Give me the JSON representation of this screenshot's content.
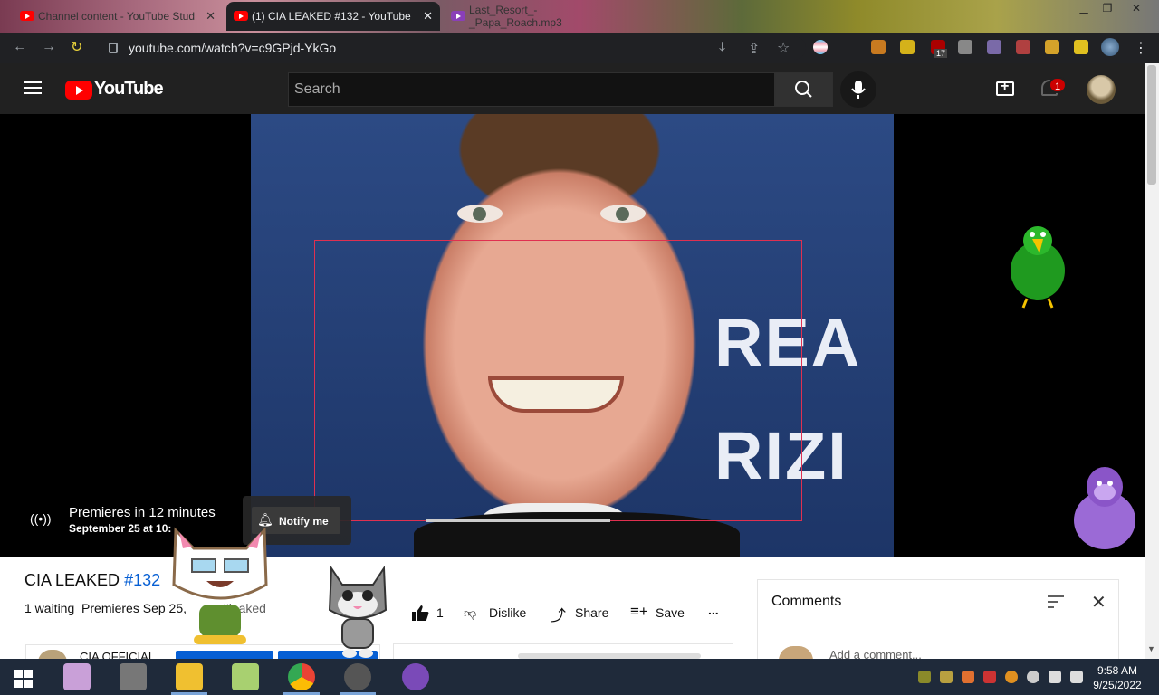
{
  "browser": {
    "tabs": [
      {
        "label": "Channel content - YouTube Stud",
        "active": false
      },
      {
        "label": "(1) CIA LEAKED #132 - YouTube",
        "active": true
      },
      {
        "label": "Last_Resort_-_Papa_Roach.mp3",
        "active": false
      }
    ],
    "url": "youtube.com/watch?v=c9GPjd-YkGo",
    "extension_badge": "17"
  },
  "youtube": {
    "logo_text": "YouTube",
    "search_placeholder": "Search",
    "notification_count": "1"
  },
  "video": {
    "background_text_1": "REA",
    "background_text_2": "RIZI",
    "premiere_title": "Premieres in 12 minutes",
    "premiere_subtitle": "September 25 at 10:",
    "notify_label": "Notify me"
  },
  "info": {
    "title_main": "CIA LEAKED ",
    "title_hashtag": "#132",
    "waiting": "1 waiting",
    "premieres": "Premieres Sep 25,",
    "tag": "#leaked",
    "likes": "1",
    "dislike_label": "Dislike",
    "share_label": "Share",
    "save_label": "Save",
    "more_label": "...",
    "channel_name": "CIA OFFICIAL"
  },
  "comments": {
    "title": "Comments",
    "close": "✕",
    "add_placeholder": "Add a comment..."
  },
  "taskbar": {
    "time": "9:58 AM",
    "date": "9/25/2022"
  },
  "colors": {
    "youtube_red": "#ff0000",
    "link_blue": "#065fd4",
    "header_dark": "#212121"
  }
}
